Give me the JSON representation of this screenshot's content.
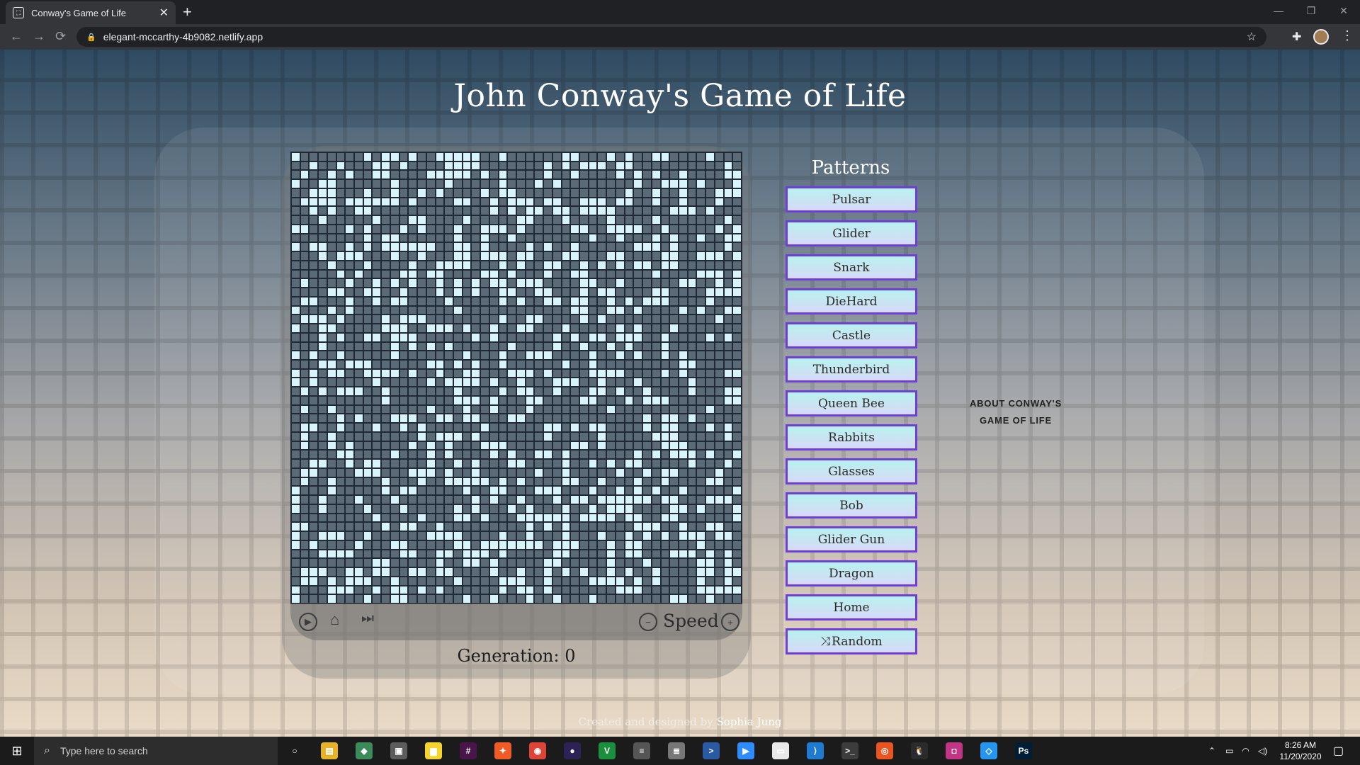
{
  "browser": {
    "tab_title": "Conway's Game of Life",
    "tab_favicon_icon": "game-of-life-icon",
    "url": "elegant-mccarthy-4b9082.netlify.app",
    "close_glyph": "✕",
    "new_tab_glyph": "+",
    "back_glyph": "←",
    "forward_glyph": "→",
    "reload_glyph": "⟳",
    "bookmark_glyph": "☆",
    "extensions_glyph": "✚",
    "menu_glyph": "⋮"
  },
  "page": {
    "title": "John Conway's Game of Life",
    "grid": {
      "rows": 50,
      "cols": 50,
      "alive_density": 0.35,
      "alive_color": "#d8f3fa",
      "dead_color": "#5b6a77"
    },
    "controls": {
      "play_icon": "play-icon",
      "clear_icon": "clear-grid-icon",
      "step_icon": "fast-forward-icon",
      "speed_label": "Speed",
      "minus_glyph": "−",
      "plus_glyph": "+"
    },
    "generation": {
      "label": "Generation:",
      "value": "0"
    },
    "patterns_title": "Patterns",
    "patterns": [
      {
        "label": "Pulsar"
      },
      {
        "label": "Glider"
      },
      {
        "label": "Snark"
      },
      {
        "label": "DieHard"
      },
      {
        "label": "Castle"
      },
      {
        "label": "Thunderbird"
      },
      {
        "label": "Queen Bee"
      },
      {
        "label": "Rabbits"
      },
      {
        "label": "Glasses"
      },
      {
        "label": "Bob"
      },
      {
        "label": "Glider Gun"
      },
      {
        "label": "Dragon"
      },
      {
        "label": "Home"
      },
      {
        "label": "Random",
        "icon": "shuffle-icon"
      }
    ],
    "about_link": "ABOUT CONWAY'S GAME OF LIFE",
    "footer": {
      "text": "Created and designed by",
      "author": "Sophia Jung"
    },
    "accent_color": "#6d3fd6"
  },
  "taskbar": {
    "search_placeholder": "Type here to search",
    "time": "8:26 AM",
    "date": "11/20/2020",
    "apps": [
      {
        "name": "cortana-icon",
        "color": "#1b1b1b",
        "glyph": "○"
      },
      {
        "name": "file-explorer-icon",
        "color": "#e8b228",
        "glyph": "▤"
      },
      {
        "name": "git-kraken-icon",
        "color": "#3b8a5a",
        "glyph": "◆"
      },
      {
        "name": "store-icon",
        "color": "#5c5c5c",
        "glyph": "▣"
      },
      {
        "name": "sticky-notes-icon",
        "color": "#f6d32d",
        "glyph": "▆"
      },
      {
        "name": "slack-icon",
        "color": "#4a154b",
        "glyph": "#"
      },
      {
        "name": "postman-icon",
        "color": "#ef5b25",
        "glyph": "✦"
      },
      {
        "name": "chrome-icon",
        "color": "#db4437",
        "glyph": "◉"
      },
      {
        "name": "eclipse-icon",
        "color": "#2c2255",
        "glyph": "●"
      },
      {
        "name": "vim-icon",
        "color": "#1a8f3c",
        "glyph": "V"
      },
      {
        "name": "database-icon",
        "color": "#555555",
        "glyph": "≡"
      },
      {
        "name": "db-tool-icon",
        "color": "#777777",
        "glyph": "≣"
      },
      {
        "name": "powershell-icon",
        "color": "#2a5aa3",
        "glyph": ">"
      },
      {
        "name": "zoom-icon",
        "color": "#2d8cff",
        "glyph": "▶"
      },
      {
        "name": "file-icon",
        "color": "#e8e8e8",
        "glyph": "▭"
      },
      {
        "name": "vscode-icon",
        "color": "#1f7ad1",
        "glyph": "⟩"
      },
      {
        "name": "terminal-icon",
        "color": "#3c3c3c",
        "glyph": ">_"
      },
      {
        "name": "ubuntu-icon",
        "color": "#e95420",
        "glyph": "◎"
      },
      {
        "name": "linux-icon",
        "color": "#2b2b2b",
        "glyph": "🐧"
      },
      {
        "name": "instagram-icon",
        "color": "#c13584",
        "glyph": "◘"
      },
      {
        "name": "docker-icon",
        "color": "#2496ed",
        "glyph": "◇"
      },
      {
        "name": "photoshop-icon",
        "color": "#001e36",
        "glyph": "Ps"
      }
    ]
  }
}
